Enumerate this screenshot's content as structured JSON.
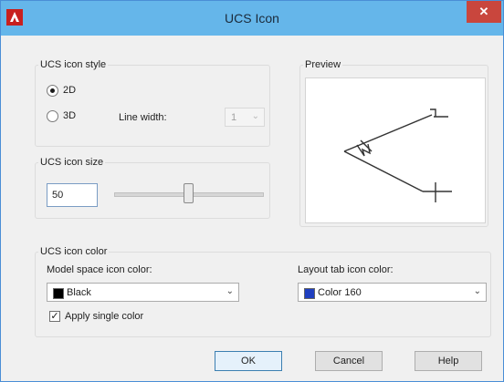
{
  "window": {
    "title": "UCS Icon",
    "close_glyph": "✕"
  },
  "style_group": {
    "title": "UCS icon style",
    "option_2d": "2D",
    "option_3d": "3D",
    "selected": "2D",
    "line_width_label": "Line width:",
    "line_width_value": "1",
    "line_width_enabled": false
  },
  "preview_group": {
    "title": "Preview"
  },
  "size_group": {
    "title": "UCS icon size",
    "value": "50",
    "slider_value": 50,
    "slider_min": 5,
    "slider_max": 95
  },
  "color_group": {
    "title": "UCS icon color",
    "model_label": "Model space icon color:",
    "model_value": "Black",
    "model_color": "#000000",
    "layout_label": "Layout tab icon color:",
    "layout_value": "Color 160",
    "layout_color": "#1f3fbf",
    "apply_single_label": "Apply single color",
    "apply_single_checked": true
  },
  "buttons": {
    "ok": "OK",
    "cancel": "Cancel",
    "help": "Help"
  },
  "colors": {
    "titlebar": "#65b6ea",
    "close": "#c9463d",
    "app_icon": "#c8201e"
  },
  "icons": [
    "autocad-app-icon",
    "close-icon",
    "chevron-down-icon",
    "checkmark-icon",
    "ucs-axes-icon"
  ]
}
